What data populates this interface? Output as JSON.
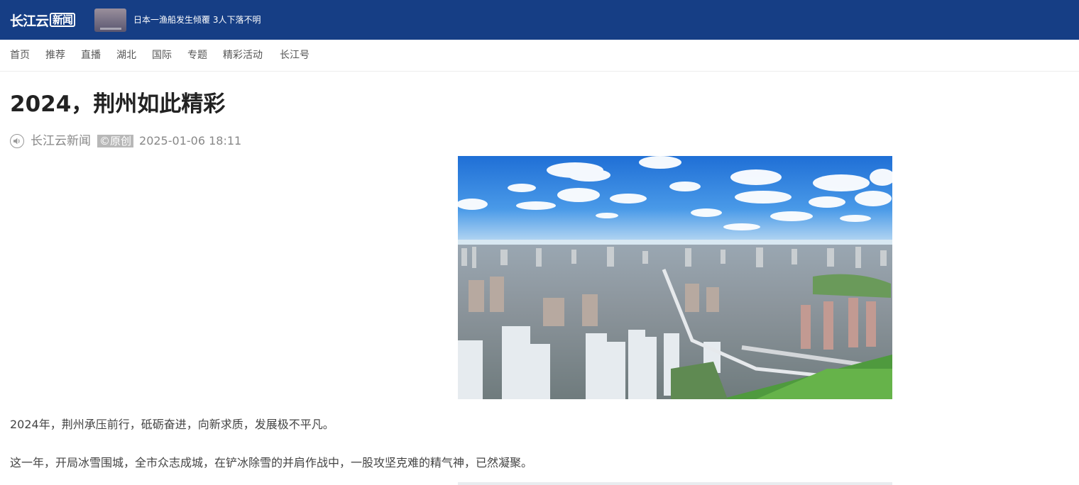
{
  "header": {
    "logo_text": "长江云",
    "logo_box_text": "新闻",
    "headline": "日本一渔船发生倾覆 3人下落不明",
    "background_color": "#163e85"
  },
  "nav": {
    "items": [
      "首页",
      "推荐",
      "直播",
      "湖北",
      "国际",
      "专题",
      "精彩活动",
      "长江号"
    ]
  },
  "article": {
    "title": "2024，荆州如此精彩",
    "source": "长江云新闻",
    "badge": "©原创",
    "time": "2025-01-06 18:11",
    "paragraphs": [
      "2024年，荆州承压前行，砥砺奋进，向新求质，发展极不平凡。",
      "这一年，开局冰雪围城，全市众志成城，在铲冰除雪的并肩作战中，一股攻坚克难的精气神，已然凝聚。"
    ]
  },
  "icons": {
    "speaker": "speaker-icon"
  }
}
